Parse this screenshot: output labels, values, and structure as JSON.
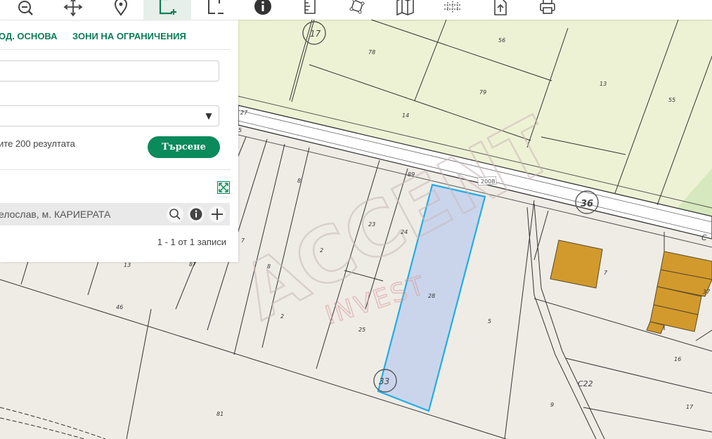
{
  "toolbar": {
    "tools": [
      {
        "name": "zoom-out-icon",
        "active": false
      },
      {
        "name": "pan-icon",
        "active": false
      },
      {
        "name": "marker-icon",
        "active": false
      },
      {
        "name": "select-area-icon",
        "active": true
      },
      {
        "name": "select-rectangle-icon",
        "active": false
      },
      {
        "name": "info-icon",
        "active": false
      },
      {
        "name": "measure-icon",
        "active": false
      },
      {
        "name": "polygon-icon",
        "active": false
      },
      {
        "name": "map-layers-icon",
        "active": false
      },
      {
        "name": "coordinate-grid-icon",
        "active": false
      },
      {
        "name": "export-icon",
        "active": false
      },
      {
        "name": "print-icon",
        "active": false
      }
    ]
  },
  "panel": {
    "tab_base": "ОД. ОСНОВА",
    "tab_restrictions": "ЗОНИ НА ОГРАНИЧЕНИЯ",
    "input_value": "",
    "select_value": "",
    "hint_text": "ите 200 резултата",
    "search_label": "Търсене",
    "result_text": "елослав, м. КАРИЕРАТА",
    "pagination": "1 - 1 от 1 записи"
  },
  "map": {
    "watermark_main": "ACCENT",
    "watermark_sub": "INVEST",
    "road_label": "2008",
    "circle_labels": [
      "17",
      "36",
      "33",
      "C22",
      "C"
    ],
    "parcel_labels": [
      "78",
      "56",
      "79",
      "13",
      "55",
      "14",
      "27",
      "5",
      "8",
      "89",
      "23",
      "24",
      "7",
      "2",
      "8",
      "28",
      "13",
      "87",
      "46",
      "25",
      "2",
      "5",
      "7",
      "37",
      "16",
      "17",
      "9",
      "81"
    ],
    "colors": {
      "background": "#efece6",
      "field_green": "#eef2d4",
      "highlight_fill": "#c7d4ec",
      "highlight_stroke": "#1eaee6",
      "building": "#d29a2c",
      "brand_green": "#0b8a5c"
    }
  }
}
